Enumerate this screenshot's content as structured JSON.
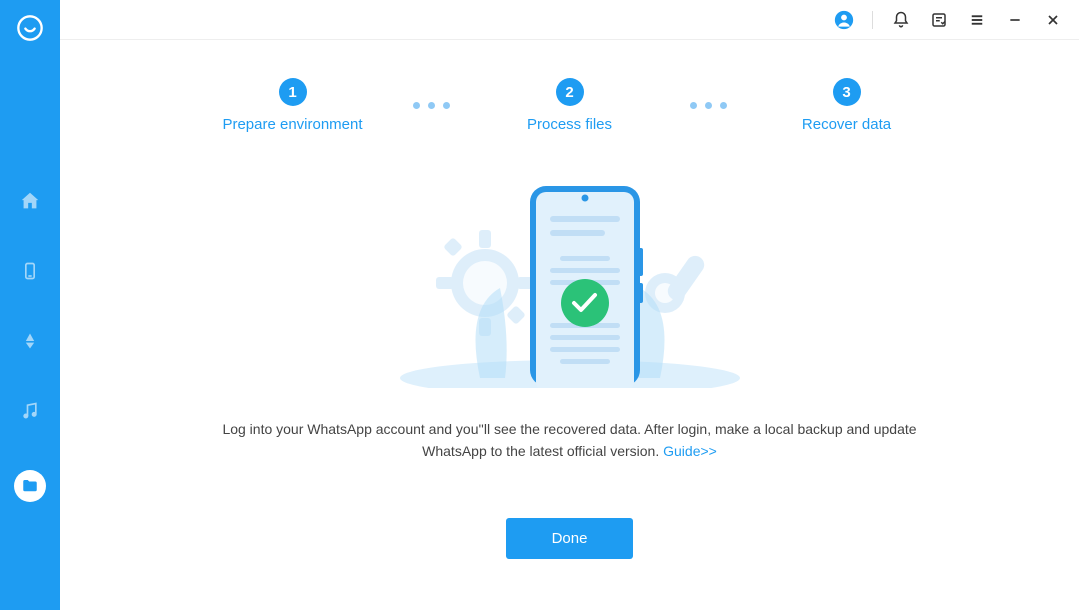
{
  "steps": [
    {
      "num": "1",
      "label": "Prepare environment"
    },
    {
      "num": "2",
      "label": "Process files"
    },
    {
      "num": "3",
      "label": "Recover data"
    }
  ],
  "instruction_text": "Log into your WhatsApp account and you''ll see the recovered data. After login, make a local backup and update WhatsApp to the latest official version. ",
  "guide_link": "Guide>>",
  "done_button": "Done"
}
